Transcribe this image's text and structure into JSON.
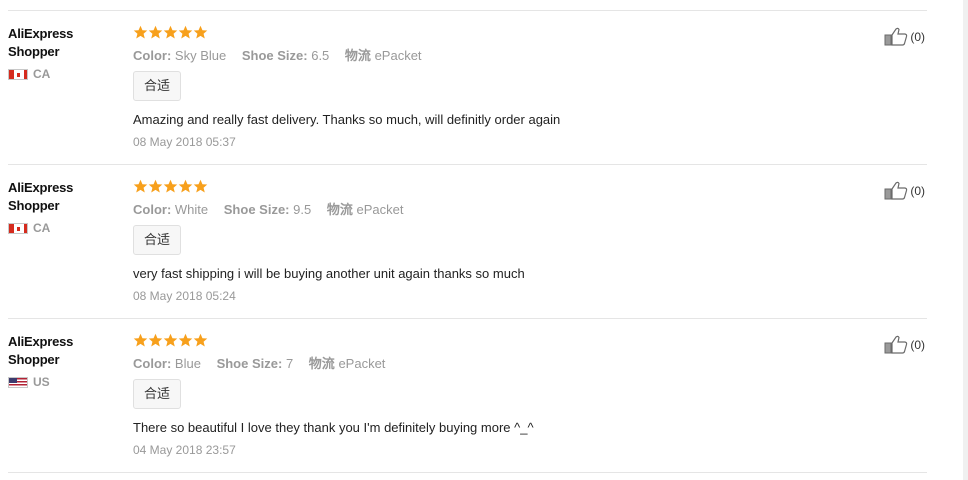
{
  "reviews": [
    {
      "user_name": "AliExpress Shopper",
      "country_code": "CA",
      "flag_icon": "flag-canada-icon",
      "rating": 5,
      "attributes": [
        {
          "key": "Color:",
          "value": "Sky Blue"
        },
        {
          "key": "Shoe Size:",
          "value": "6.5"
        },
        {
          "key": "物流",
          "value": "ePacket"
        }
      ],
      "tag": "合适",
      "text": "Amazing and really fast delivery. Thanks so much, will definitly order again",
      "date": "08 May 2018 05:37",
      "helpful_count": "(0)"
    },
    {
      "user_name": "AliExpress Shopper",
      "country_code": "CA",
      "flag_icon": "flag-canada-icon",
      "rating": 5,
      "attributes": [
        {
          "key": "Color:",
          "value": "White"
        },
        {
          "key": "Shoe Size:",
          "value": "9.5"
        },
        {
          "key": "物流",
          "value": "ePacket"
        }
      ],
      "tag": "合适",
      "text": "very fast shipping i will be buying another unit again thanks so much",
      "date": "08 May 2018 05:24",
      "helpful_count": "(0)"
    },
    {
      "user_name": "AliExpress Shopper",
      "country_code": "US",
      "flag_icon": "flag-usa-icon",
      "rating": 5,
      "attributes": [
        {
          "key": "Color:",
          "value": "Blue"
        },
        {
          "key": "Shoe Size:",
          "value": "7"
        },
        {
          "key": "物流",
          "value": "ePacket"
        }
      ],
      "tag": "合适",
      "text": "There so beautiful I love they thank you I'm definitely buying more ^_^",
      "date": "04 May 2018 23:57",
      "helpful_count": "(0)"
    }
  ],
  "colors": {
    "star": "#f7a01c",
    "meta_text": "#999999",
    "divider": "#e5e5e5"
  },
  "icons": {
    "star": "star-icon",
    "helpful": "thumbs-up-icon"
  }
}
